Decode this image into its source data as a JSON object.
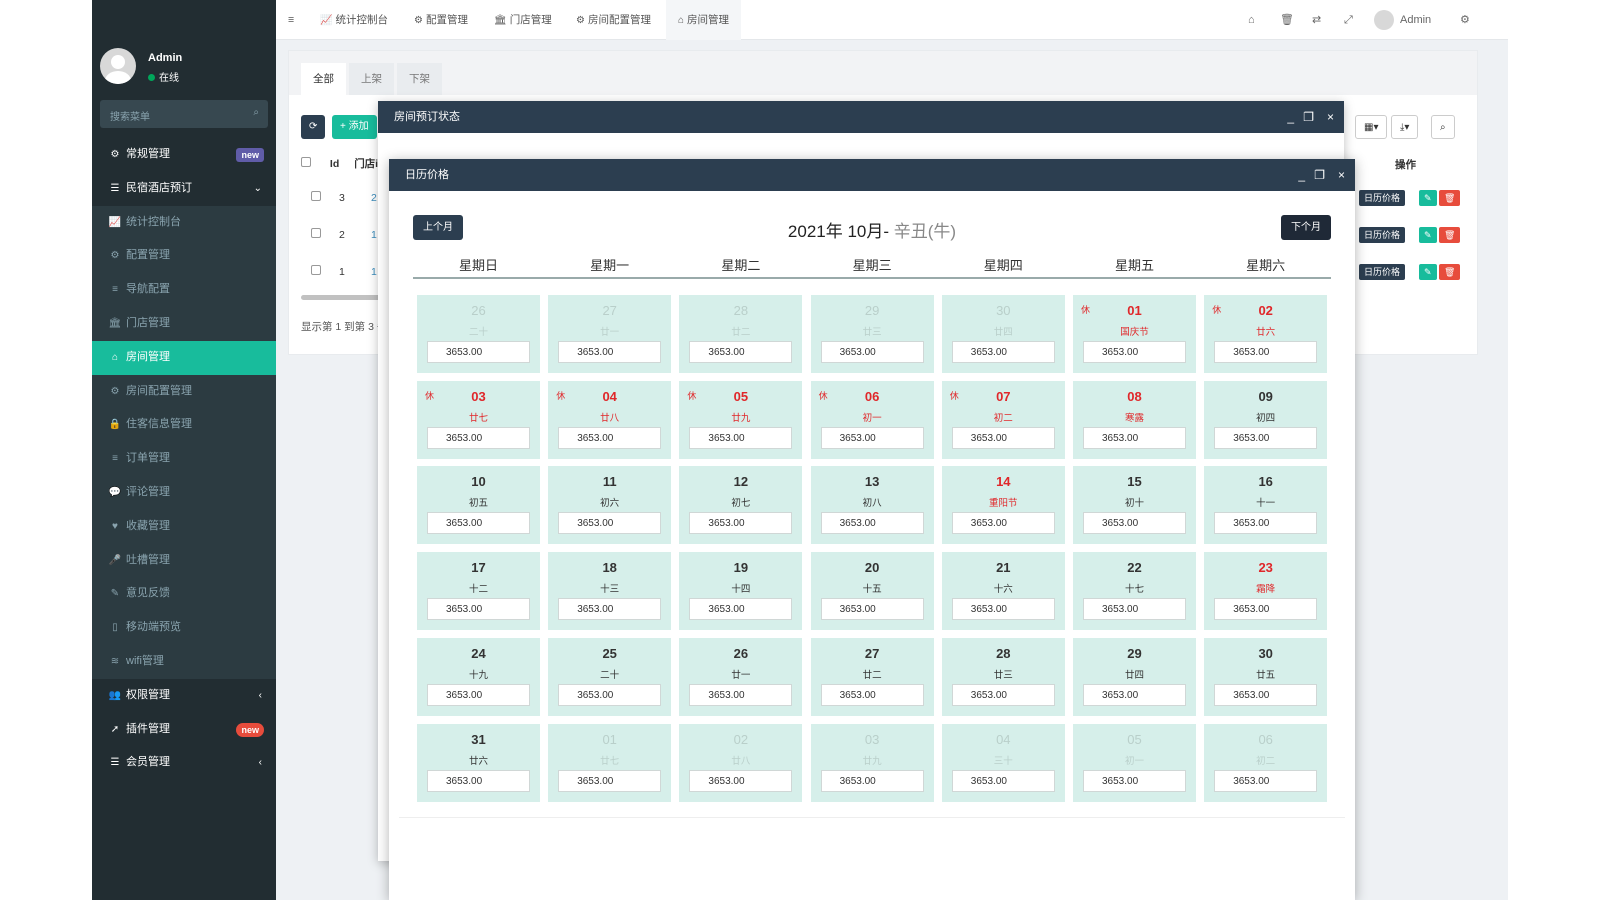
{
  "sidebar": {
    "user_name": "Admin",
    "user_status": "在线",
    "search_placeholder": "搜索菜单",
    "items": [
      {
        "label": "常规管理",
        "icon": "cogs-icon",
        "glyph": "⚙",
        "kind": "top",
        "badge": "new",
        "badge_color": "#605ca8"
      },
      {
        "label": "民宿酒店预订",
        "icon": "list-icon",
        "glyph": "☰",
        "kind": "top",
        "arrow": "⌄"
      },
      {
        "label": "统计控制台",
        "icon": "chart-icon",
        "glyph": "📈",
        "kind": "sub"
      },
      {
        "label": "配置管理",
        "icon": "gear-icon",
        "glyph": "⚙",
        "kind": "sub"
      },
      {
        "label": "导航配置",
        "icon": "list-icon",
        "glyph": "≡",
        "kind": "sub"
      },
      {
        "label": "门店管理",
        "icon": "bank-icon",
        "glyph": "🏛",
        "kind": "sub"
      },
      {
        "label": "房间管理",
        "icon": "home-icon",
        "glyph": "⌂",
        "kind": "active"
      },
      {
        "label": "房间配置管理",
        "icon": "gear-icon",
        "glyph": "⚙",
        "kind": "sub"
      },
      {
        "label": "住客信息管理",
        "icon": "lock-icon",
        "glyph": "🔒",
        "kind": "sub"
      },
      {
        "label": "订单管理",
        "icon": "list-icon",
        "glyph": "≡",
        "kind": "sub"
      },
      {
        "label": "评论管理",
        "icon": "comments-icon",
        "glyph": "💬",
        "kind": "sub"
      },
      {
        "label": "收藏管理",
        "icon": "heart-icon",
        "glyph": "♥",
        "kind": "sub"
      },
      {
        "label": "吐槽管理",
        "icon": "microphone-icon",
        "glyph": "🎤",
        "kind": "sub"
      },
      {
        "label": "意见反馈",
        "icon": "pencil-icon",
        "glyph": "✎",
        "kind": "sub"
      },
      {
        "label": "移动端预览",
        "icon": "mobile-icon",
        "glyph": "▯",
        "kind": "sub"
      },
      {
        "label": "wifi管理",
        "icon": "wifi-icon",
        "glyph": "≋",
        "kind": "sub"
      },
      {
        "label": "权限管理",
        "icon": "group-icon",
        "glyph": "👥",
        "kind": "top",
        "arrow": "‹"
      },
      {
        "label": "插件管理",
        "icon": "rocket-icon",
        "glyph": "➚",
        "kind": "top",
        "badge": "new",
        "badge_color": "#e74c3c"
      },
      {
        "label": "会员管理",
        "icon": "list-icon",
        "glyph": "☰",
        "kind": "top",
        "arrow": "‹"
      }
    ]
  },
  "topnav": {
    "menu_glyph": "≡",
    "tabs": [
      "统计控制台",
      "配置管理",
      "门店管理",
      "房间配置管理",
      "房间管理"
    ],
    "admin_label": "Admin"
  },
  "panel": {
    "tabs": [
      "全部",
      "上架",
      "下架"
    ],
    "add_label": "+ 添加",
    "headers": [
      "Id",
      "门店id",
      "操作"
    ],
    "rows": [
      {
        "id": "3",
        "store": "2"
      },
      {
        "id": "2",
        "store": "1"
      },
      {
        "id": "1",
        "store": "1"
      }
    ],
    "row_action": "日历价格",
    "footer": "显示第 1 到第 3 条"
  },
  "dialog_booking": {
    "title": "房间预订状态"
  },
  "dialog_calendar": {
    "title": "日历价格",
    "prev_label": "上个月",
    "next_label": "下个月",
    "month_title": "2021年 10月- ",
    "ganzhi": "辛丑(牛)",
    "weekdays": [
      "星期日",
      "星期一",
      "星期二",
      "星期三",
      "星期四",
      "星期五",
      "星期六"
    ],
    "rest_mark": "休",
    "days": [
      {
        "day": "26",
        "lunar": "二十",
        "price": "3653.00",
        "other": true
      },
      {
        "day": "27",
        "lunar": "廿一",
        "price": "3653.00",
        "other": true
      },
      {
        "day": "28",
        "lunar": "廿二",
        "price": "3653.00",
        "other": true
      },
      {
        "day": "29",
        "lunar": "廿三",
        "price": "3653.00",
        "other": true
      },
      {
        "day": "30",
        "lunar": "廿四",
        "price": "3653.00",
        "other": true
      },
      {
        "day": "01",
        "lunar": "国庆节",
        "price": "3653.00",
        "holiday": true,
        "rest": true
      },
      {
        "day": "02",
        "lunar": "廿六",
        "price": "3653.00",
        "holiday": true,
        "rest": true
      },
      {
        "day": "03",
        "lunar": "廿七",
        "price": "3653.00",
        "holiday": true,
        "rest": true
      },
      {
        "day": "04",
        "lunar": "廿八",
        "price": "3653.00",
        "holiday": true,
        "rest": true
      },
      {
        "day": "05",
        "lunar": "廿九",
        "price": "3653.00",
        "holiday": true,
        "rest": true
      },
      {
        "day": "06",
        "lunar": "初一",
        "price": "3653.00",
        "holiday": true,
        "rest": true
      },
      {
        "day": "07",
        "lunar": "初二",
        "price": "3653.00",
        "holiday": true,
        "rest": true
      },
      {
        "day": "08",
        "lunar": "寒露",
        "price": "3653.00",
        "holiday": true
      },
      {
        "day": "09",
        "lunar": "初四",
        "price": "3653.00"
      },
      {
        "day": "10",
        "lunar": "初五",
        "price": "3653.00"
      },
      {
        "day": "11",
        "lunar": "初六",
        "price": "3653.00"
      },
      {
        "day": "12",
        "lunar": "初七",
        "price": "3653.00"
      },
      {
        "day": "13",
        "lunar": "初八",
        "price": "3653.00"
      },
      {
        "day": "14",
        "lunar": "重阳节",
        "price": "3653.00",
        "holiday": true
      },
      {
        "day": "15",
        "lunar": "初十",
        "price": "3653.00"
      },
      {
        "day": "16",
        "lunar": "十一",
        "price": "3653.00"
      },
      {
        "day": "17",
        "lunar": "十二",
        "price": "3653.00"
      },
      {
        "day": "18",
        "lunar": "十三",
        "price": "3653.00"
      },
      {
        "day": "19",
        "lunar": "十四",
        "price": "3653.00"
      },
      {
        "day": "20",
        "lunar": "十五",
        "price": "3653.00"
      },
      {
        "day": "21",
        "lunar": "十六",
        "price": "3653.00"
      },
      {
        "day": "22",
        "lunar": "十七",
        "price": "3653.00"
      },
      {
        "day": "23",
        "lunar": "霜降",
        "price": "3653.00",
        "holiday": true
      },
      {
        "day": "24",
        "lunar": "十九",
        "price": "3653.00"
      },
      {
        "day": "25",
        "lunar": "二十",
        "price": "3653.00"
      },
      {
        "day": "26",
        "lunar": "廿一",
        "price": "3653.00"
      },
      {
        "day": "27",
        "lunar": "廿二",
        "price": "3653.00"
      },
      {
        "day": "28",
        "lunar": "廿三",
        "price": "3653.00"
      },
      {
        "day": "29",
        "lunar": "廿四",
        "price": "3653.00"
      },
      {
        "day": "30",
        "lunar": "廿五",
        "price": "3653.00"
      },
      {
        "day": "31",
        "lunar": "廿六",
        "price": "3653.00"
      },
      {
        "day": "01",
        "lunar": "廿七",
        "price": "3653.00",
        "other": true
      },
      {
        "day": "02",
        "lunar": "廿八",
        "price": "3653.00",
        "other": true
      },
      {
        "day": "03",
        "lunar": "廿九",
        "price": "3653.00",
        "other": true
      },
      {
        "day": "04",
        "lunar": "三十",
        "price": "3653.00",
        "other": true
      },
      {
        "day": "05",
        "lunar": "初一",
        "price": "3653.00",
        "other": true
      },
      {
        "day": "06",
        "lunar": "初二",
        "price": "3653.00",
        "other": true
      }
    ]
  },
  "colors": {
    "sidebar_bg": "#222d32",
    "active": "#18bc9c",
    "dialog_header": "#2c3e50",
    "cell_bg": "#d6efea",
    "holiday": "#e0272a"
  }
}
